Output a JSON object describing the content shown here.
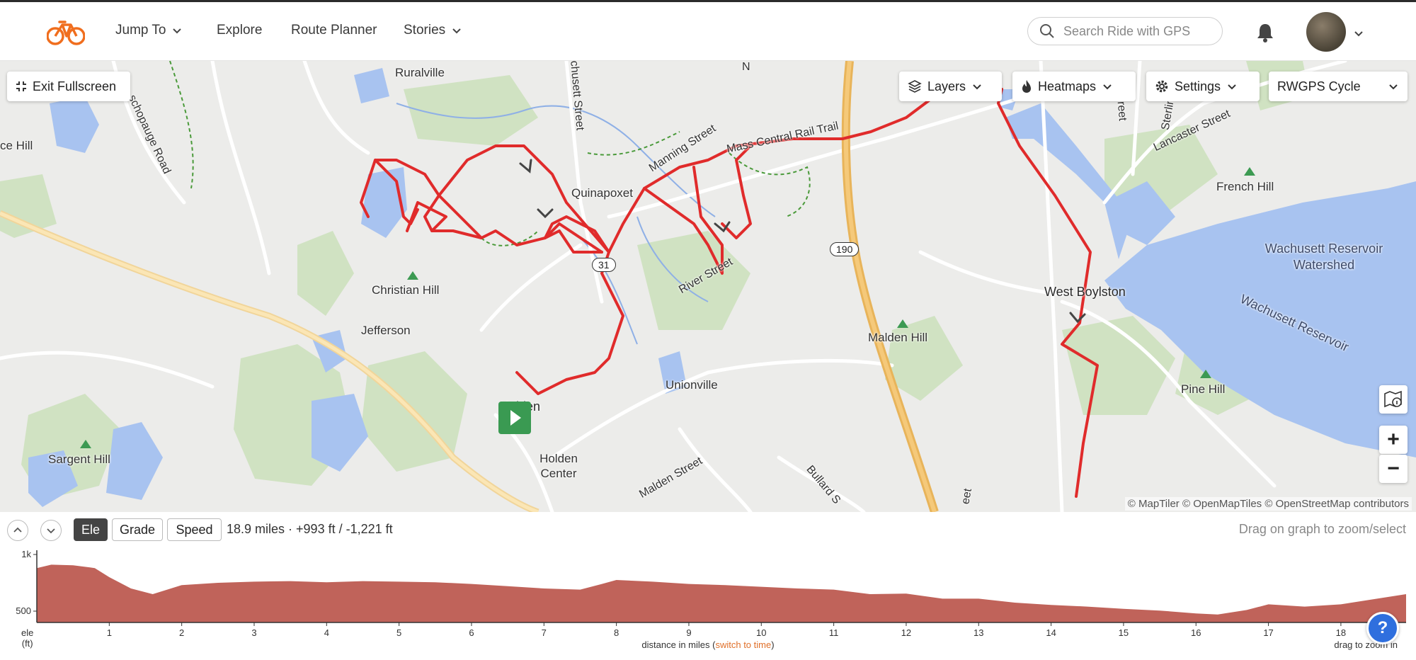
{
  "nav": {
    "logo_icon": "bicycle-logo-icon",
    "items": [
      {
        "label": "Jump To",
        "dropdown": true
      },
      {
        "label": "Explore",
        "dropdown": false
      },
      {
        "label": "Route Planner",
        "dropdown": false
      },
      {
        "label": "Stories",
        "dropdown": true
      }
    ],
    "search_placeholder": "Search Ride with GPS",
    "accent": "#f06e1e"
  },
  "map_controls": {
    "exit_fullscreen": "Exit Fullscreen",
    "layers": "Layers",
    "heatmaps": "Heatmaps",
    "settings": "Settings",
    "map_style": "RWGPS Cycle",
    "zoom_in": "+",
    "zoom_out": "−",
    "attribution": "© MapTiler © OpenMapTiles © OpenStreetMap contributors"
  },
  "map_labels": {
    "places": [
      "Ruralville",
      "Quinapoxet",
      "Christian Hill",
      "Jefferson",
      "Holden",
      "Holden Center",
      "Unionville",
      "Malden Hill",
      "West Boylston",
      "French Hill",
      "Pine Hill",
      "Sargent Hill",
      "ce Hill"
    ],
    "water": [
      "Wachusett Reservoir Watershed",
      "Wachusett Reservoir"
    ],
    "streets": [
      "Manning Street",
      "Mass Central Rail Trail",
      "River Street",
      "Malden Street",
      "Bullard S",
      "Lancaster Street",
      "Sterling",
      "chusett Street",
      "schopauge Road",
      "N",
      "reet",
      "eet"
    ],
    "route_shields": [
      "31",
      "190"
    ]
  },
  "route": {
    "color": "#e02b2b"
  },
  "elevation": {
    "tabs": [
      "Ele",
      "Grade",
      "Speed"
    ],
    "active_tab": "Ele",
    "stats": "18.9 miles · +993 ft / -1,221 ft",
    "drag_hint": "Drag on graph to zoom/select",
    "x_title_prefix": "distance in miles (",
    "x_title_link": "switch to time",
    "x_title_suffix": ")",
    "drag_zoom": "drag to zoom in",
    "y_unit_line1": "ele",
    "y_unit_line2": "(ft)",
    "fill_color": "#c0635a"
  },
  "chart_data": {
    "type": "area",
    "xlabel": "distance in miles",
    "ylabel": "ele (ft)",
    "xlim": [
      0,
      18.9
    ],
    "ylim": [
      400,
      1000
    ],
    "x_ticks": [
      1,
      2,
      3,
      4,
      5,
      6,
      7,
      8,
      9,
      10,
      11,
      12,
      13,
      14,
      15,
      16,
      17,
      18
    ],
    "y_ticks": [
      {
        "value": 500,
        "label": "500"
      },
      {
        "value": 1000,
        "label": "1k"
      }
    ],
    "x": [
      0,
      0.2,
      0.5,
      0.8,
      1.0,
      1.3,
      1.6,
      1.8,
      2.0,
      2.5,
      3.0,
      3.5,
      4.0,
      4.5,
      5.0,
      5.5,
      6.0,
      6.5,
      7.0,
      7.5,
      7.8,
      8.0,
      8.5,
      9.0,
      9.5,
      10.0,
      10.5,
      11.0,
      11.5,
      12.0,
      12.5,
      13.0,
      13.5,
      14.0,
      14.5,
      15.0,
      15.5,
      16.0,
      16.3,
      16.7,
      17.0,
      17.5,
      18.0,
      18.5,
      18.9
    ],
    "y": [
      880,
      910,
      905,
      880,
      800,
      700,
      650,
      690,
      730,
      750,
      760,
      765,
      755,
      765,
      760,
      755,
      740,
      720,
      700,
      690,
      740,
      775,
      760,
      740,
      730,
      715,
      700,
      690,
      650,
      655,
      610,
      610,
      575,
      555,
      540,
      520,
      505,
      480,
      470,
      510,
      560,
      540,
      560,
      610,
      650
    ]
  }
}
